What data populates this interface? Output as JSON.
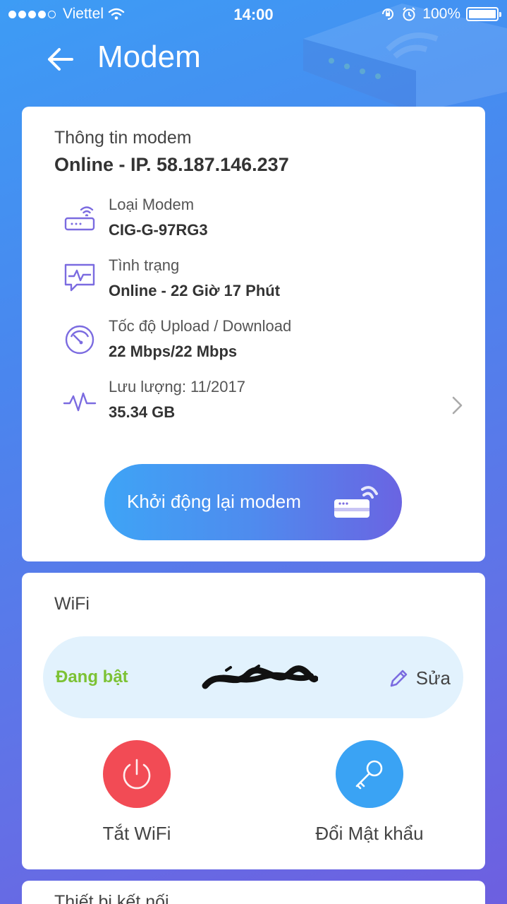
{
  "status_bar": {
    "carrier": "Viettel",
    "time": "14:00",
    "battery": "100%",
    "icons": [
      "signal-dots-icon",
      "wifi-icon",
      "rotation-lock-icon",
      "alarm-icon",
      "battery-icon"
    ]
  },
  "header": {
    "title": "Modem",
    "back_icon": "arrow-left-icon"
  },
  "modem_card": {
    "section_title": "Thông tin modem",
    "status": "Online - IP. 58.187.146.237",
    "rows": [
      {
        "icon": "router-icon",
        "label": "Loại Modem",
        "value": "CIG-G-97RG3"
      },
      {
        "icon": "monitor-pulse-icon",
        "label": "Tình trạng",
        "value": "Online - 22 Giờ 17 Phút"
      },
      {
        "icon": "speedometer-icon",
        "label": "Tốc độ Upload / Download",
        "value": "22 Mbps/22 Mbps"
      },
      {
        "icon": "pulse-line-icon",
        "label": "Lưu lượng: 11/2017",
        "value": "35.34 GB"
      }
    ],
    "restart_button": "Khởi động lại modem"
  },
  "wifi_card": {
    "section_title": "WiFi",
    "state": "Đang bật",
    "edit_label": "Sửa",
    "turn_off_label": "Tắt WiFi",
    "change_password_label": "Đổi Mật khẩu"
  },
  "next_card": {
    "section_title": "Thiết bị kết nối"
  },
  "colors": {
    "accent_purple": "#7b6be0",
    "wifi_on_green": "#7cc234",
    "off_red": "#f24b55",
    "key_blue": "#3aa3f4"
  }
}
